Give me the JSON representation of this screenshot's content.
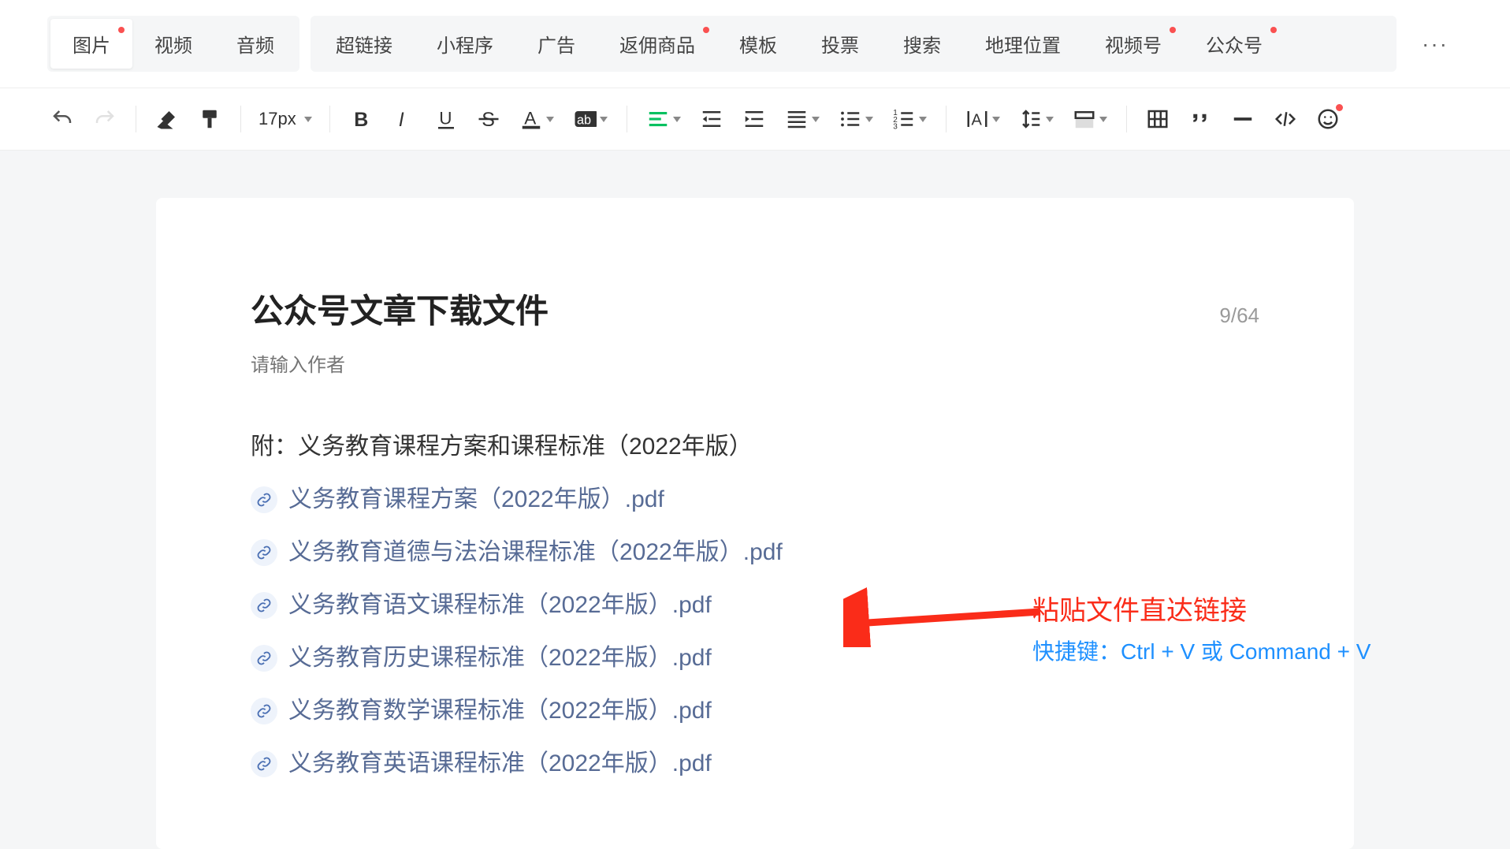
{
  "insert_tabs_left": [
    {
      "label": "图片",
      "dot": true,
      "active": true
    },
    {
      "label": "视频",
      "dot": false,
      "active": false
    },
    {
      "label": "音频",
      "dot": false,
      "active": false
    }
  ],
  "insert_tabs_right": [
    {
      "label": "超链接",
      "dot": false
    },
    {
      "label": "小程序",
      "dot": false
    },
    {
      "label": "广告",
      "dot": false
    },
    {
      "label": "返佣商品",
      "dot": true
    },
    {
      "label": "模板",
      "dot": false
    },
    {
      "label": "投票",
      "dot": false
    },
    {
      "label": "搜索",
      "dot": false
    },
    {
      "label": "地理位置",
      "dot": false
    },
    {
      "label": "视频号",
      "dot": true
    },
    {
      "label": "公众号",
      "dot": true
    }
  ],
  "font_size": "17px",
  "title": "公众号文章下载文件",
  "title_counter": "9/64",
  "author_placeholder": "请输入作者",
  "attachment_heading": "附：义务教育课程方案和课程标准（2022年版）",
  "files": [
    "义务教育课程方案（2022年版）.pdf",
    "义务教育道德与法治课程标准（2022年版）.pdf",
    "义务教育语文课程标准（2022年版）.pdf",
    "义务教育历史课程标准（2022年版）.pdf",
    "义务教育数学课程标准（2022年版）.pdf",
    "义务教育英语课程标准（2022年版）.pdf"
  ],
  "annotation_red": "粘贴文件直达链接",
  "annotation_blue": "快捷键：Ctrl + V 或 Command + V",
  "emoji_dot": true
}
